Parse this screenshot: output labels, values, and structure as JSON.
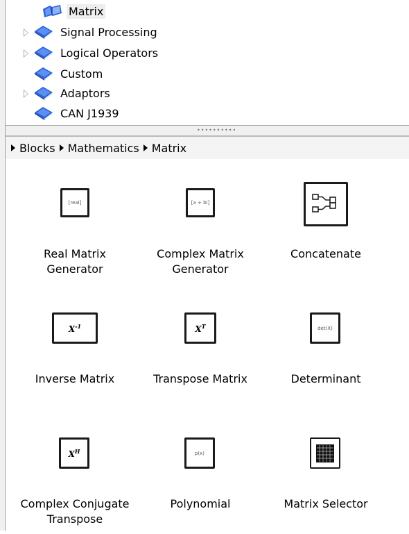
{
  "tree": {
    "items": [
      {
        "label": "Matrix",
        "icon": "open-book-icon",
        "expandable": false,
        "selected": true
      },
      {
        "label": "Signal Processing",
        "icon": "book-icon",
        "expandable": true,
        "selected": false
      },
      {
        "label": "Logical Operators",
        "icon": "book-icon",
        "expandable": true,
        "selected": false
      },
      {
        "label": "Custom",
        "icon": "book-icon",
        "expandable": false,
        "selected": false
      },
      {
        "label": "Adaptors",
        "icon": "book-icon",
        "expandable": true,
        "selected": false
      },
      {
        "label": "CAN J1939",
        "icon": "book-icon",
        "expandable": false,
        "selected": false
      }
    ]
  },
  "breadcrumb": {
    "items": [
      "Blocks",
      "Mathematics",
      "Matrix"
    ]
  },
  "blocks": [
    {
      "name": "Real Matrix Generator",
      "line1": "Real Matrix",
      "line2": "Generator",
      "icon_text": "[real]"
    },
    {
      "name": "Complex Matrix Generator",
      "line1": "Complex Matrix",
      "line2": "Generator",
      "icon_text": "[a + bi]"
    },
    {
      "name": "Concatenate",
      "line1": "Concatenate",
      "line2": "",
      "icon_text": ""
    },
    {
      "name": "Inverse Matrix",
      "line1": "Inverse Matrix",
      "line2": "",
      "icon_text": "X",
      "icon_sup": "-1"
    },
    {
      "name": "Transpose Matrix",
      "line1": "Transpose Matrix",
      "line2": "",
      "icon_text": "X",
      "icon_sup": "T"
    },
    {
      "name": "Determinant",
      "line1": "Determinant",
      "line2": "",
      "icon_text": "det(X)"
    },
    {
      "name": "Complex Conjugate Transpose",
      "line1": "Complex Conjugate",
      "line2": "Transpose",
      "icon_text": "X",
      "icon_sup": "H"
    },
    {
      "name": "Polynomial",
      "line1": "Polynomial",
      "line2": "",
      "icon_text": "p(x)"
    },
    {
      "name": "Matrix Selector",
      "line1": "Matrix Selector",
      "line2": "",
      "icon_text": ""
    }
  ],
  "colors": {
    "book_blue": "#2a63d8",
    "selection_bg": "#eeeeee",
    "icon_border": "#1a1a1a"
  }
}
